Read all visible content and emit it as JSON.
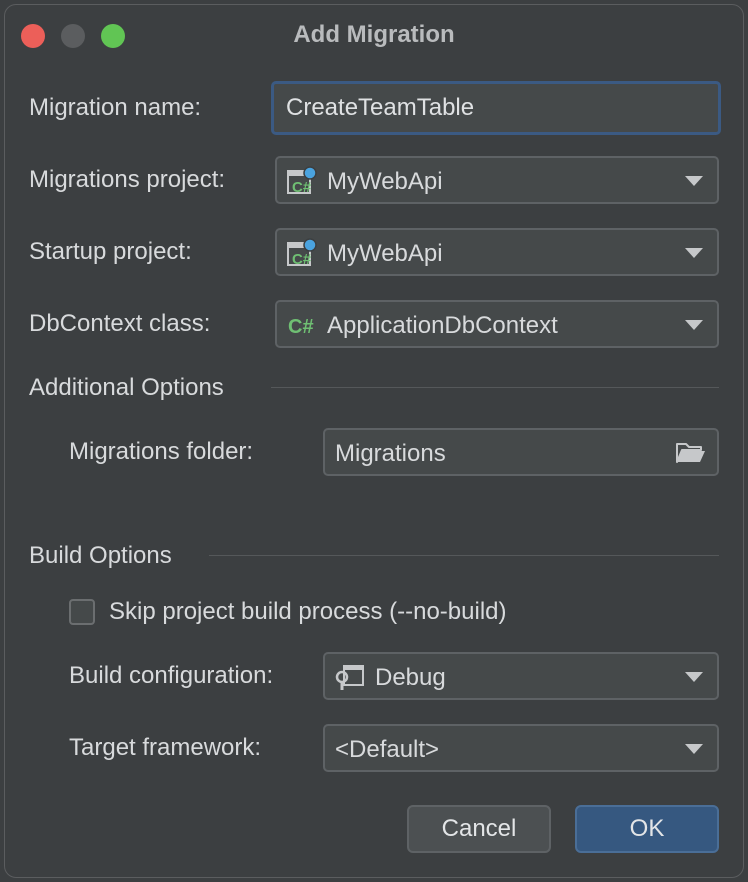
{
  "window": {
    "title": "Add Migration"
  },
  "form": {
    "migration_name_label": "Migration name:",
    "migration_name_value": "CreateTeamTable",
    "migrations_project_label": "Migrations project:",
    "migrations_project_value": "MyWebApi",
    "startup_project_label": "Startup project:",
    "startup_project_value": "MyWebApi",
    "dbcontext_label": "DbContext class:",
    "dbcontext_value": "ApplicationDbContext"
  },
  "additional_options": {
    "heading": "Additional Options",
    "migrations_folder_label": "Migrations folder:",
    "migrations_folder_value": "Migrations"
  },
  "build_options": {
    "heading": "Build Options",
    "skip_build_label": "Skip project build process (--no-build)",
    "skip_build_checked": false,
    "build_config_label": "Build configuration:",
    "build_config_value": "Debug",
    "target_framework_label": "Target framework:",
    "target_framework_value": "<Default>"
  },
  "buttons": {
    "cancel": "Cancel",
    "ok": "OK"
  },
  "icons": {
    "project": "csharp-project-icon",
    "csharp": "csharp-class-icon",
    "folder": "folder-open-icon",
    "build_config": "run-configuration-icon",
    "dropdown": "chevron-down-icon"
  },
  "colors": {
    "background": "#3c3f41",
    "field_bg": "#45494a",
    "focus_border": "#3b5a83",
    "ok_button": "#365880",
    "csharp_green": "#6fbf73",
    "project_blue": "#4aa3df"
  }
}
